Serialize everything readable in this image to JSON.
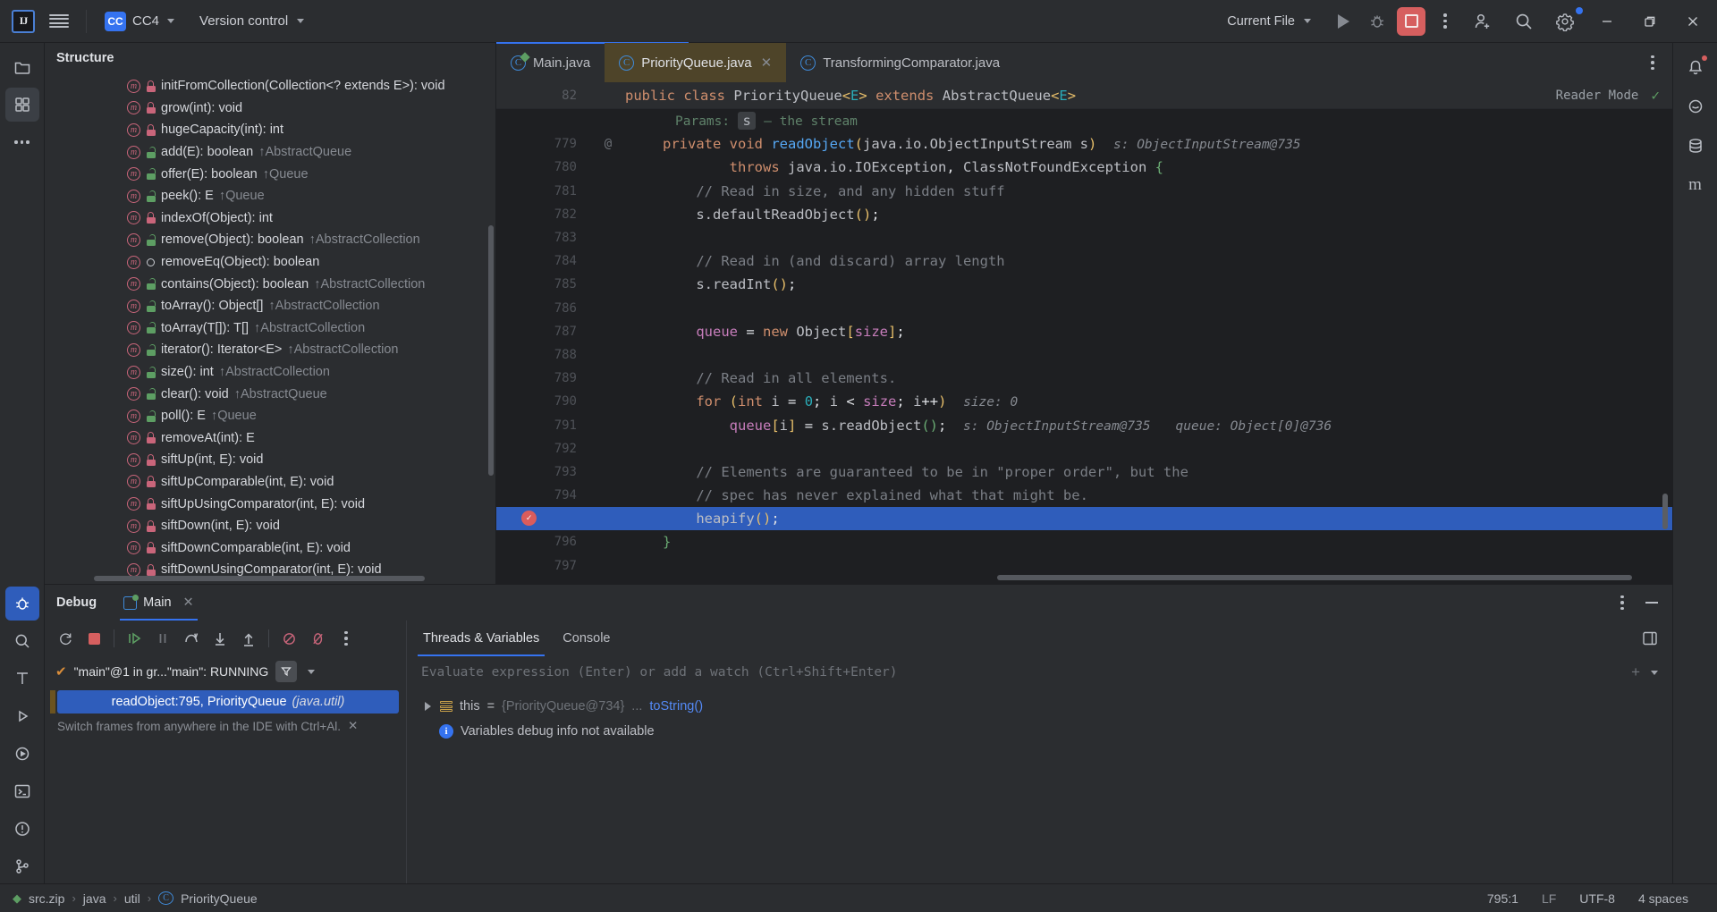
{
  "toolbar": {
    "project_badge": "CC",
    "project_name": "CC4",
    "vcs_label": "Version control",
    "run_config": "Current File",
    "icons": {
      "menu": "hamburger-menu-icon",
      "run": "run-icon",
      "debug": "debug-icon",
      "stop": "stop-icon",
      "more": "more-actions-icon",
      "account": "add-account-icon",
      "search": "search-everywhere-icon",
      "settings": "settings-gear-icon",
      "minimize": "minimize-icon",
      "maximize": "maximize-icon",
      "close": "close-icon"
    }
  },
  "structure": {
    "title": "Structure",
    "items": [
      {
        "name": "initFromCollection(Collection<? extends E>): void",
        "over": "",
        "vis": "private"
      },
      {
        "name": "grow(int): void",
        "over": "",
        "vis": "private"
      },
      {
        "name": "hugeCapacity(int): int",
        "over": "",
        "vis": "private"
      },
      {
        "name": "add(E): boolean",
        "over": "↑AbstractQueue",
        "vis": "public"
      },
      {
        "name": "offer(E): boolean",
        "over": "↑Queue",
        "vis": "public"
      },
      {
        "name": "peek(): E",
        "over": "↑Queue",
        "vis": "public"
      },
      {
        "name": "indexOf(Object): int",
        "over": "",
        "vis": "private"
      },
      {
        "name": "remove(Object): boolean",
        "over": "↑AbstractCollection",
        "vis": "public"
      },
      {
        "name": "removeEq(Object): boolean",
        "over": "",
        "vis": "package"
      },
      {
        "name": "contains(Object): boolean",
        "over": "↑AbstractCollection",
        "vis": "public"
      },
      {
        "name": "toArray(): Object[]",
        "over": "↑AbstractCollection",
        "vis": "public"
      },
      {
        "name": "toArray(T[]): T[]",
        "over": "↑AbstractCollection",
        "vis": "public"
      },
      {
        "name": "iterator(): Iterator<E>",
        "over": "↑AbstractCollection",
        "vis": "public"
      },
      {
        "name": "size(): int",
        "over": "↑AbstractCollection",
        "vis": "public"
      },
      {
        "name": "clear(): void",
        "over": "↑AbstractQueue",
        "vis": "public"
      },
      {
        "name": "poll(): E",
        "over": "↑Queue",
        "vis": "public"
      },
      {
        "name": "removeAt(int): E",
        "over": "",
        "vis": "private"
      },
      {
        "name": "siftUp(int, E): void",
        "over": "",
        "vis": "private"
      },
      {
        "name": "siftUpComparable(int, E): void",
        "over": "",
        "vis": "private"
      },
      {
        "name": "siftUpUsingComparator(int, E): void",
        "over": "",
        "vis": "private"
      },
      {
        "name": "siftDown(int, E): void",
        "over": "",
        "vis": "private"
      },
      {
        "name": "siftDownComparable(int, E): void",
        "over": "",
        "vis": "private"
      },
      {
        "name": "siftDownUsingComparator(int, E): void",
        "over": "",
        "vis": "private"
      }
    ]
  },
  "editor": {
    "tabs": [
      {
        "label": "Main.java",
        "active": false,
        "closable": false,
        "runnable": true
      },
      {
        "label": "PriorityQueue.java",
        "active": true,
        "closable": true,
        "runnable": false
      },
      {
        "label": "TransformingComparator.java",
        "active": false,
        "closable": false,
        "runnable": false
      }
    ],
    "sticky_line_number": "82",
    "reader_mode_label": "Reader Mode",
    "breakpoint_line": "795",
    "highlighted_line_text": "heapify();",
    "lines": [
      {
        "n": "",
        "text": "doc-params"
      },
      {
        "n": "779",
        "text": "private void readObject(java.io.ObjectInputStream s)",
        "hint": "s: ObjectInputStream@735",
        "anno": "@"
      },
      {
        "n": "780",
        "text": "        throws java.io.IOException, ClassNotFoundException {"
      },
      {
        "n": "781",
        "text": "    // Read in size, and any hidden stuff"
      },
      {
        "n": "782",
        "text": "    s.defaultReadObject();"
      },
      {
        "n": "783",
        "text": ""
      },
      {
        "n": "784",
        "text": "    // Read in (and discard) array length"
      },
      {
        "n": "785",
        "text": "    s.readInt();"
      },
      {
        "n": "786",
        "text": ""
      },
      {
        "n": "787",
        "text": "    queue = new Object[size];"
      },
      {
        "n": "788",
        "text": ""
      },
      {
        "n": "789",
        "text": "    // Read in all elements."
      },
      {
        "n": "790",
        "text": "    for (int i = 0; i < size; i++)",
        "hint": "size: 0"
      },
      {
        "n": "791",
        "text": "        queue[i] = s.readObject();",
        "hint": "s: ObjectInputStream@735",
        "hint2": "queue: Object[0]@736"
      },
      {
        "n": "792",
        "text": ""
      },
      {
        "n": "793",
        "text": "    // Elements are guaranteed to be in \"proper order\", but the"
      },
      {
        "n": "794",
        "text": "    // spec has never explained what that might be."
      },
      {
        "n": "795",
        "text": "    heapify();",
        "highlighted": true
      },
      {
        "n": "796",
        "text": "}"
      },
      {
        "n": "797",
        "text": ""
      }
    ],
    "doc_params_label": "Params:",
    "doc_params_chip": "s",
    "doc_params_desc": "— the stream"
  },
  "debug": {
    "title": "Debug",
    "session_tab": "Main",
    "tabs": [
      {
        "label": "Threads & Variables",
        "active": true
      },
      {
        "label": "Console",
        "active": false
      }
    ],
    "thread_label": "\"main\"@1 in gr...\"main\": RUNNING",
    "frame": "readObject:795, PriorityQueue",
    "frame_pkg": "(java.util)",
    "frame_hint": "Switch frames from anywhere in the IDE with Ctrl+Al.",
    "eval_placeholder": "Evaluate expression (Enter) or add a watch (Ctrl+Shift+Enter)",
    "variables": [
      {
        "key": "this",
        "eq": "=",
        "value": "{PriorityQueue@734}",
        "ellipsis": "...",
        "link": "toString()"
      }
    ],
    "notice": "Variables debug info not available",
    "toolbar_icons": [
      "rerun-icon",
      "stop-icon",
      "resume-icon",
      "pause-icon",
      "step-over-icon",
      "step-into-icon",
      "step-out-icon",
      "mute-breakpoints-icon",
      "view-breakpoints-icon",
      "more-icon"
    ]
  },
  "status": {
    "breadcrumbs": [
      "src.zip",
      "java",
      "util",
      "PriorityQueue"
    ],
    "caret": "795:1",
    "line_sep": "LF",
    "encoding": "UTF-8",
    "indent": "4 spaces"
  },
  "colors": {
    "accent": "#3573f0",
    "tab_active_bg": "#4e4429",
    "selection": "#2f5dbb",
    "breakpoint": "#db5c5c",
    "stop": "#d65f5f"
  }
}
